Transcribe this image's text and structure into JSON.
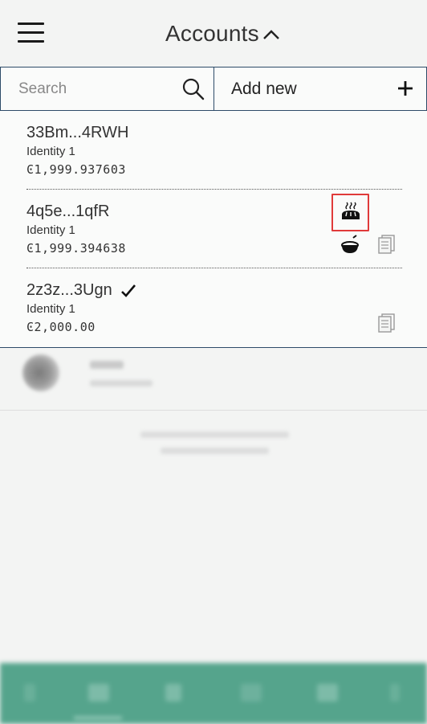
{
  "header": {
    "title": "Accounts",
    "menu_icon": "hamburger-menu-icon",
    "expand_icon": "chevron-up-icon"
  },
  "toolbar": {
    "search_placeholder": "Search",
    "search_value": "",
    "search_icon": "search-icon",
    "add_new_label": "Add new",
    "add_icon": "plus-icon"
  },
  "accounts": [
    {
      "address": "33Bm...4RWH",
      "identity": "Identity 1",
      "balance": "Ͼ1,999.937603",
      "baker_icon": "delegation-bowl-icon",
      "selected": false
    },
    {
      "address": "4q5e...1qfR",
      "identity": "Identity 1",
      "balance": "Ͼ1,999.394638",
      "baker_icon": "baker-bread-icon",
      "selected": false
    },
    {
      "address": "2z3z...3Ugn",
      "identity": "Identity 1",
      "balance": "Ͼ2,000.00",
      "selected": true
    }
  ],
  "colors": {
    "border": "#2d4b68",
    "highlight": "#e03a3a",
    "bottom_nav": "#55a48c"
  }
}
